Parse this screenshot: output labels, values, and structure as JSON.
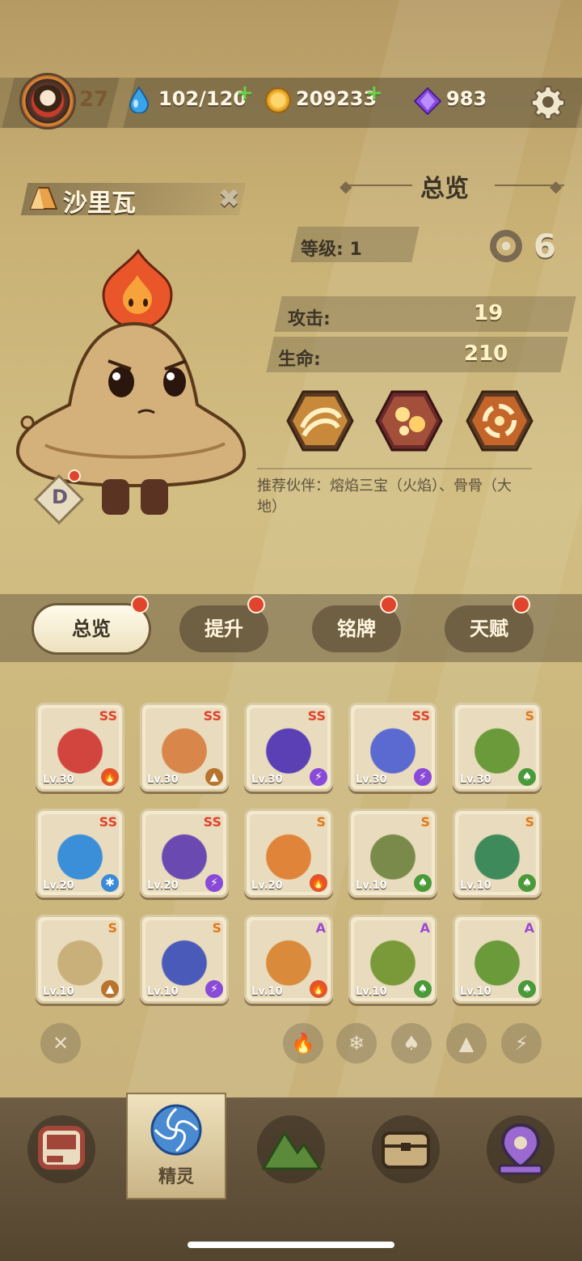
{
  "topbar": {
    "player_level": "27",
    "stamina": "102/120",
    "coins": "209233",
    "gems": "983",
    "plus": "+"
  },
  "spirit": {
    "name": "沙里瓦",
    "close": "✖",
    "rank": "D"
  },
  "overview": {
    "title": "总览",
    "level_label": "等级: 1",
    "attack_label": "攻击:",
    "attack_value": "19",
    "hp_label": "生命:",
    "hp_value": "210",
    "recommend": "推荐伙伴：熔焰三宝（火焰）、骨骨（大地）"
  },
  "tabs": [
    {
      "label": "总览",
      "active": true
    },
    {
      "label": "提升"
    },
    {
      "label": "铭牌"
    },
    {
      "label": "天赋"
    }
  ],
  "cards": [
    {
      "rank": "SS",
      "lv": "Lv.30",
      "element": "fire",
      "color": "#d2453e"
    },
    {
      "rank": "SS",
      "lv": "Lv.30",
      "element": "earth",
      "color": "#d8864a"
    },
    {
      "rank": "SS",
      "lv": "Lv.30",
      "element": "thunder",
      "color": "#5a3fb5"
    },
    {
      "rank": "SS",
      "lv": "Lv.30",
      "element": "thunder",
      "color": "#5b6ad0"
    },
    {
      "rank": "S",
      "lv": "Lv.30",
      "element": "leaf",
      "color": "#6a9a3a"
    },
    {
      "rank": "SS",
      "lv": "Lv.20",
      "element": "ice",
      "color": "#3b8ed8"
    },
    {
      "rank": "SS",
      "lv": "Lv.20",
      "element": "thunder",
      "color": "#6a4ab0"
    },
    {
      "rank": "S",
      "lv": "Lv.20",
      "element": "fire",
      "color": "#e0843a"
    },
    {
      "rank": "S",
      "lv": "Lv.10",
      "element": "leaf",
      "color": "#7a8a4a"
    },
    {
      "rank": "S",
      "lv": "Lv.10",
      "element": "leaf",
      "color": "#3f8a5a"
    },
    {
      "rank": "S",
      "lv": "Lv.10",
      "element": "earth",
      "color": "#c9b07a"
    },
    {
      "rank": "S",
      "lv": "Lv.10",
      "element": "thunder",
      "color": "#4a5ab8"
    },
    {
      "rank": "A",
      "lv": "Lv.10",
      "element": "fire",
      "color": "#d98a3a"
    },
    {
      "rank": "A",
      "lv": "Lv.10",
      "element": "leaf",
      "color": "#7a9a3a"
    },
    {
      "rank": "A",
      "lv": "Lv.10",
      "element": "leaf",
      "color": "#6a9a3a"
    }
  ],
  "rank_colors": {
    "SS": "#e0442c",
    "S": "#e07a1c",
    "A": "#9a4ad0"
  },
  "element_colors": {
    "fire": "#e2542a",
    "earth": "#b8742c",
    "thunder": "#8a4ad8",
    "leaf": "#4a9a3a",
    "ice": "#3a8ad8"
  },
  "filters": {
    "clear": "✕",
    "fire": "🔥",
    "ice": "❄",
    "leaf": "♠",
    "earth": "▲",
    "thunder": "⚡"
  },
  "bottomnav": {
    "active_label": "精灵"
  }
}
